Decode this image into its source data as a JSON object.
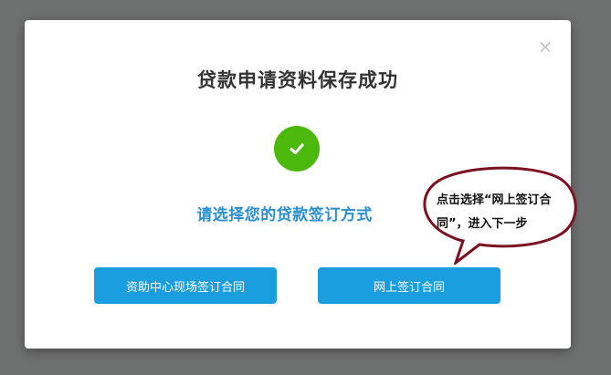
{
  "modal": {
    "close_glyph": "×",
    "title": "贷款申请资料保存成功",
    "success_icon": "check-circle-icon",
    "subtitle": "请选择您的贷款签订方式",
    "buttons": {
      "onsite": "资助中心现场签订合同",
      "online": "网上签订合同"
    }
  },
  "annotation": {
    "text": "点击选择“网上签订合同”，进入下一步"
  },
  "colors": {
    "overlay": "#6f7070",
    "primary": "#1a9ee0",
    "success": "#4cb80c",
    "subtitle": "#2a8fd0",
    "bubble_border": "#7a1020"
  }
}
